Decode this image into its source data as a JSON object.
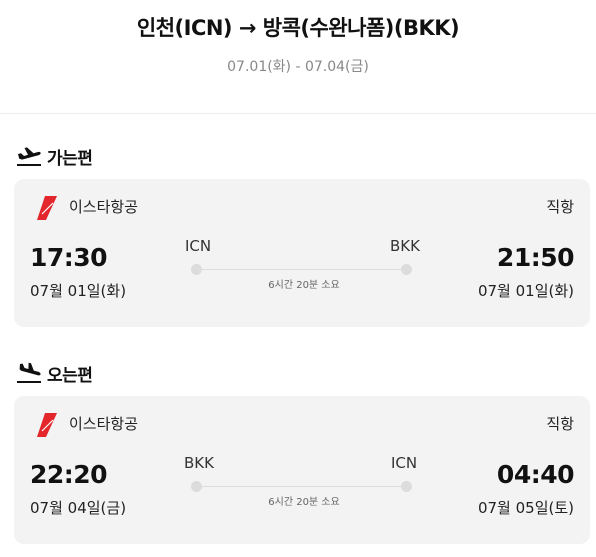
{
  "header": {
    "route_title": "인천(ICN) → 방콕(수완나폼)(BKK)",
    "date_range": "07.01(화) - 07.04(금)"
  },
  "colors": {
    "airline_brand": "#e3262b",
    "card_background": "#f3f3f3",
    "date_text": "#888888"
  },
  "legs": [
    {
      "label": "가는편",
      "icon": "plane-takeoff-icon",
      "airline": "이스타항공",
      "flight_type": "직항",
      "departure": {
        "time": "17:30",
        "date": "07월 01일(화)",
        "code": "ICN"
      },
      "arrival": {
        "time": "21:50",
        "date": "07월 01일(화)",
        "code": "BKK"
      },
      "duration": "6시간 20분 소요"
    },
    {
      "label": "오는편",
      "icon": "plane-landing-icon",
      "airline": "이스타항공",
      "flight_type": "직항",
      "departure": {
        "time": "22:20",
        "date": "07월 04일(금)",
        "code": "BKK"
      },
      "arrival": {
        "time": "04:40",
        "date": "07월 05일(토)",
        "code": "ICN"
      },
      "duration": "6시간 20분 소요"
    }
  ]
}
